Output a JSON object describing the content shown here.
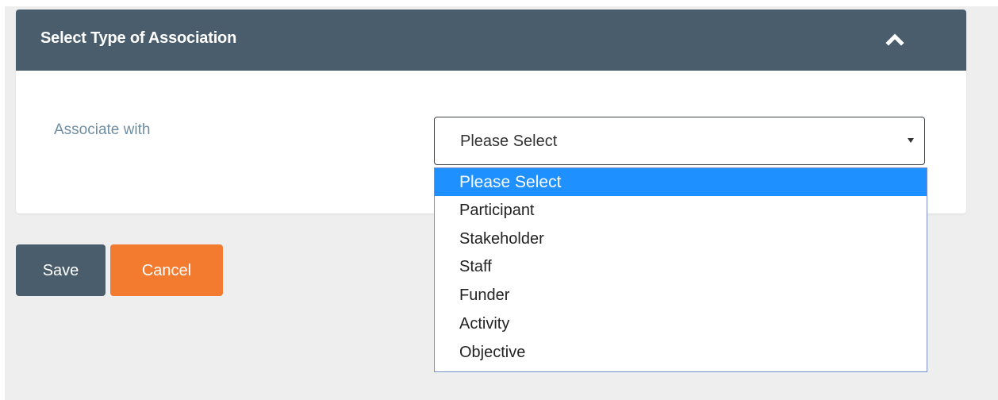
{
  "panel": {
    "title": "Select Type of Association"
  },
  "form": {
    "label": "Associate with",
    "selected_value": "Please Select",
    "options": [
      "Please Select",
      "Participant",
      "Stakeholder",
      "Staff",
      "Funder",
      "Activity",
      "Objective"
    ],
    "highlighted_index": 0
  },
  "buttons": {
    "save": "Save",
    "cancel": "Cancel"
  },
  "icons": {
    "collapse": "chevron-up-icon",
    "dropdown_arrow": "caret-down-icon"
  },
  "colors": {
    "header_bg": "#4a5d6c",
    "accent_orange": "#f37b2f",
    "highlight_blue": "#1e90ff",
    "label_color": "#6f8ea3"
  }
}
